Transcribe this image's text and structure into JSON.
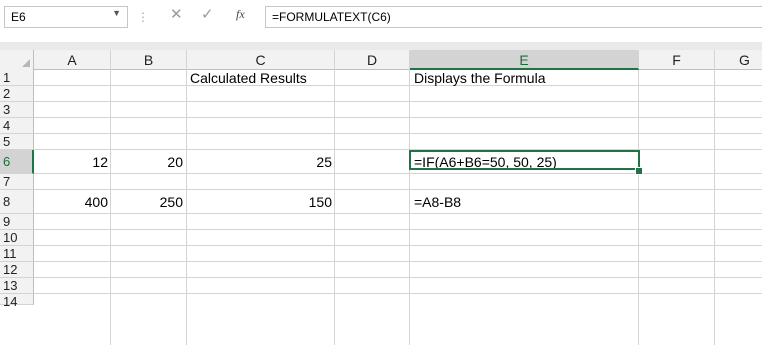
{
  "formula_bar": {
    "name_box": "E6",
    "name_box_dropdown_icon": "chevron-down-icon",
    "separator_icon": "vertical-dots-icon",
    "cancel_icon": "close-icon",
    "enter_icon": "check-icon",
    "fx_label": "fx",
    "formula": "=FORMULATEXT(C6)"
  },
  "sheet": {
    "columns": [
      "A",
      "B",
      "C",
      "D",
      "E",
      "F",
      "G"
    ],
    "rows": [
      "1",
      "2",
      "3",
      "4",
      "5",
      "6",
      "7",
      "8",
      "9",
      "10",
      "11",
      "12",
      "13",
      "14"
    ],
    "selected_column": "E",
    "selected_row": "6",
    "active_cell": "E6",
    "cells": {
      "C1": "Calculated Results",
      "E1": "Displays the Formula",
      "A6": "12",
      "B6": "20",
      "C6": "25",
      "E6": "=IF(A6+B6=50, 50, 25)",
      "A8": "400",
      "B8": "250",
      "C8": "150",
      "E8": "=A8-B8"
    },
    "accent_color": "#217346"
  }
}
